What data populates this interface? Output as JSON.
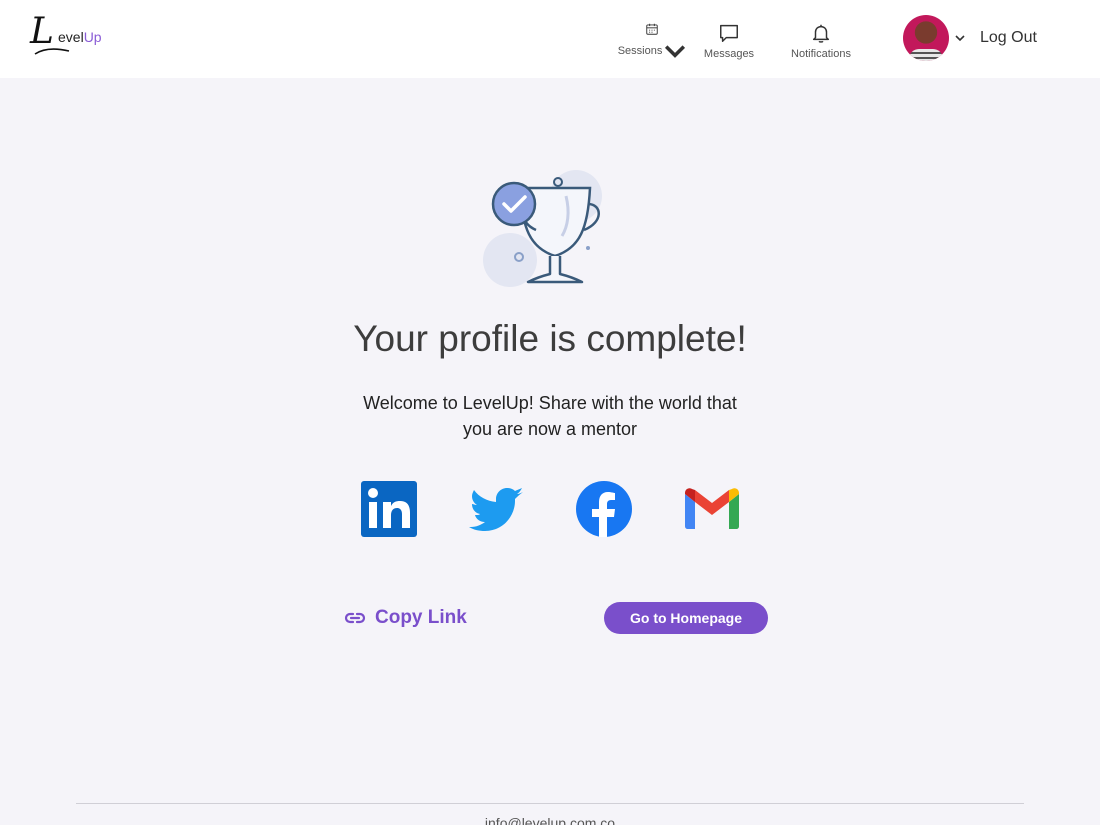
{
  "header": {
    "logo_initial": "L",
    "logo_level": "evel",
    "logo_up": "Up",
    "nav": {
      "sessions": "Sessions",
      "messages": "Messages",
      "notifications": "Notifications"
    },
    "logout_label": "Log Out"
  },
  "main": {
    "title": "Your profile is complete!",
    "subtitle_line1": "Welcome to LevelUp! Share with the world that",
    "subtitle_line2": "you are now a mentor",
    "share_icons": [
      "linkedin-icon",
      "twitter-icon",
      "facebook-icon",
      "gmail-icon"
    ],
    "copy_link_label": "Copy Link",
    "homepage_button_label": "Go to Homepage"
  },
  "footer": {
    "email": "info@levelup.com.co"
  },
  "colors": {
    "accent": "#7a4fcb",
    "linkedin": "#0a66c2",
    "twitter": "#1d9bf0",
    "facebook": "#1877f2",
    "background": "#f5f4f9"
  }
}
